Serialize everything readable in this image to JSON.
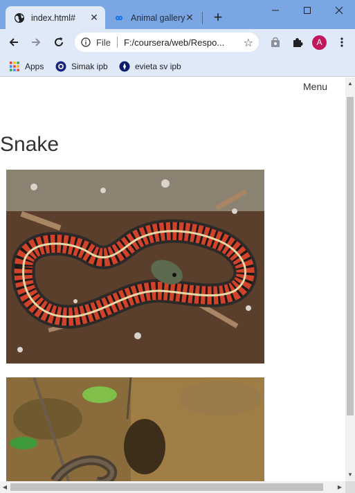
{
  "tabs": [
    {
      "title": "index.html#",
      "close": "✕"
    },
    {
      "title": "Animal gallery",
      "close": "✕"
    }
  ],
  "new_tab": "+",
  "window_controls": {
    "minimize": "minimize-icon",
    "maximize": "maximize-icon",
    "close": "close-icon"
  },
  "omnibox": {
    "security_label": "File",
    "url": "F:/coursera/web/Respo..."
  },
  "profile": {
    "initial": "A",
    "color": "#c2185b"
  },
  "bookmarks": [
    {
      "label": "Apps",
      "icon": "apps-grid-icon"
    },
    {
      "label": "Simak ipb",
      "icon": "simak-ipb-icon"
    },
    {
      "label": "evieta sv ipb",
      "icon": "evieta-ipb-icon"
    }
  ],
  "page": {
    "menu_label": "Menu",
    "title": "Snake",
    "images": [
      {
        "name": "red-sided garter snake on wood chips"
      },
      {
        "name": "snake near water and mud"
      }
    ]
  },
  "colors": {
    "tabstrip": "#7aa7e4",
    "toolbar": "#dfe9f7",
    "page_bg": "#ffffff"
  }
}
